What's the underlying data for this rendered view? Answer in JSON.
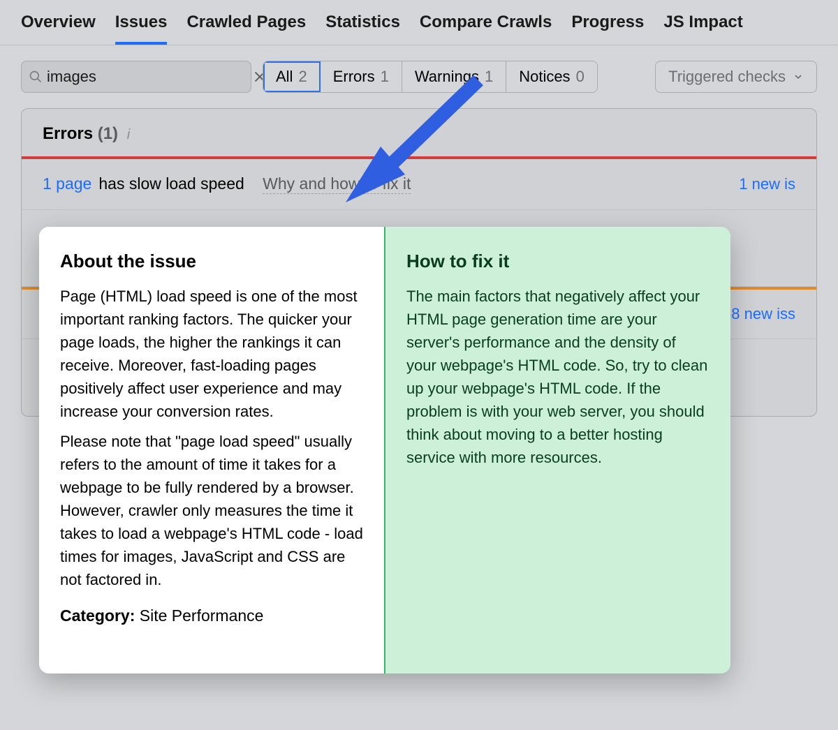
{
  "tabs": [
    "Overview",
    "Issues",
    "Crawled Pages",
    "Statistics",
    "Compare Crawls",
    "Progress",
    "JS Impact"
  ],
  "active_tab_index": 1,
  "search": {
    "value": "images"
  },
  "filters": [
    {
      "label": "All",
      "count": 2,
      "selected": true
    },
    {
      "label": "Errors",
      "count": 1
    },
    {
      "label": "Warnings",
      "count": 1
    },
    {
      "label": "Notices",
      "count": 0
    }
  ],
  "triggered_label": "Triggered checks",
  "errors_header": {
    "title": "Errors",
    "count": "(1)"
  },
  "issue": {
    "count_text": "1 page",
    "rest_text": "has slow load speed",
    "why_label": "Why and how to fix it",
    "new_text": "1 new is"
  },
  "row2_new": "68 new iss",
  "popup": {
    "about_title": "About the issue",
    "about_p1": "Page (HTML) load speed is one of the most important ranking factors. The quicker your page loads, the higher the rankings it can receive. Moreover, fast-loading pages positively affect user experience and may increase your conversion rates.",
    "about_p2": "Please note that \"page load speed\" usually refers to the amount of time it takes for a webpage to be fully rendered by a browser. However, crawler only measures the time it takes to load a webpage's HTML code - load times for images, JavaScript and CSS are not factored in.",
    "category_label": "Category:",
    "category_value": "Site Performance",
    "fix_title": "How to fix it",
    "fix_body": "The main factors that negatively affect your HTML page generation time are your server's performance and the density of your webpage's HTML code. So, try to clean up your webpage's HTML code. If the problem is with your web server, you should think about moving to a better hosting service with more resources."
  }
}
